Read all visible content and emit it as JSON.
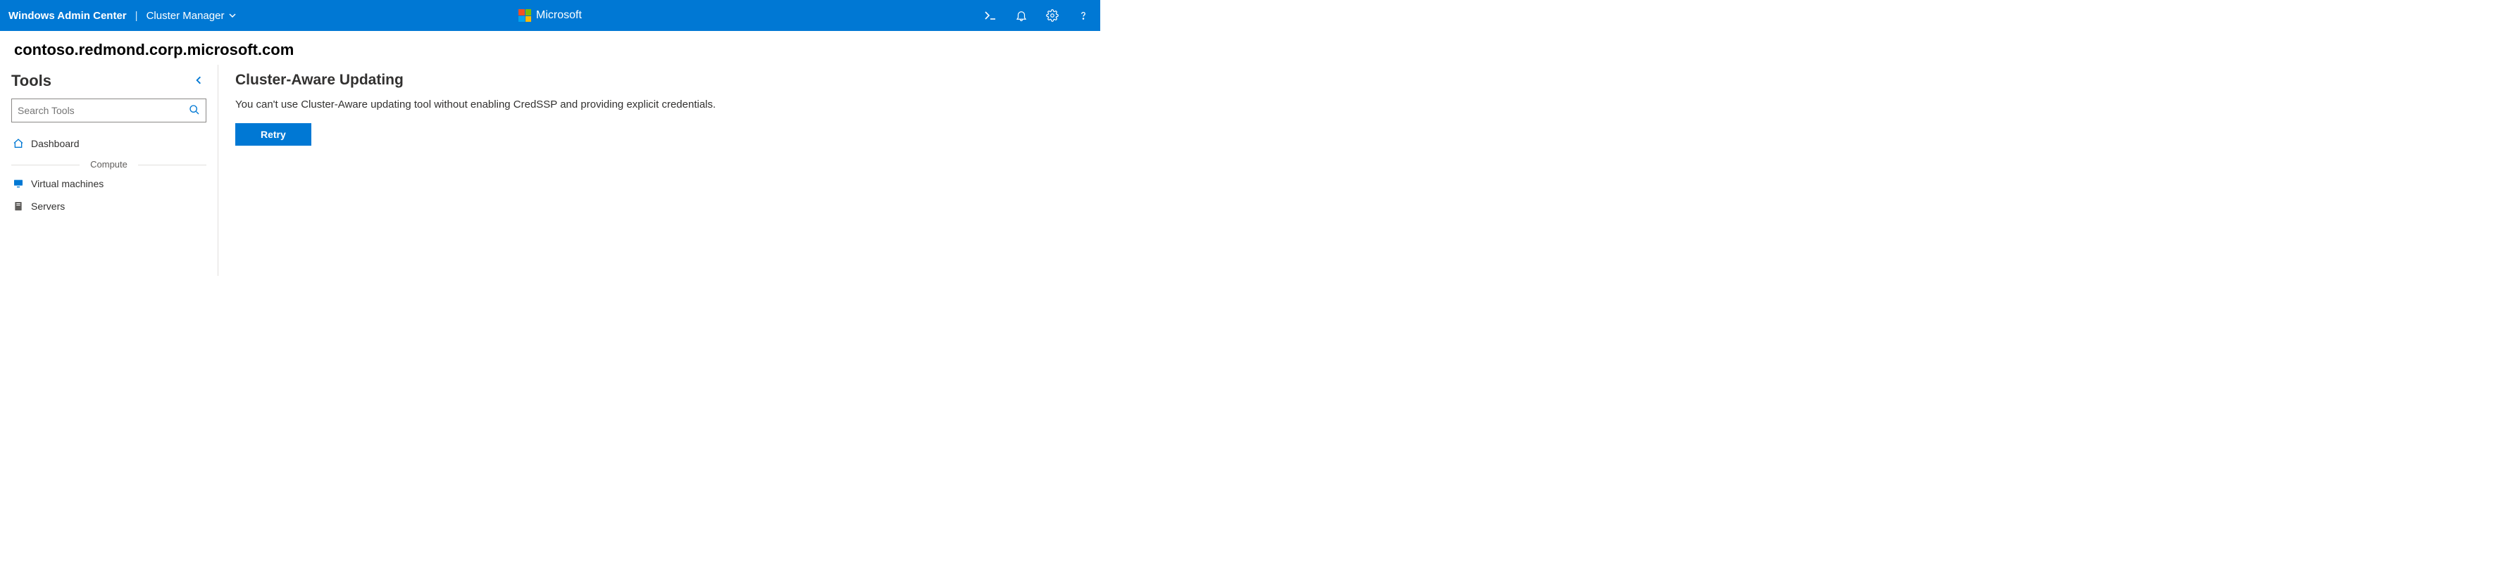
{
  "header": {
    "product": "Windows Admin Center",
    "scope_label": "Cluster Manager",
    "brand": "Microsoft"
  },
  "breadcrumb": {
    "host": "contoso.redmond.corp.microsoft.com"
  },
  "sidebar": {
    "title": "Tools",
    "search_placeholder": "Search Tools",
    "items": [
      {
        "label": "Dashboard"
      }
    ],
    "group_label": "Compute",
    "compute_items": [
      {
        "label": "Virtual machines"
      },
      {
        "label": "Servers"
      }
    ]
  },
  "main": {
    "title": "Cluster-Aware Updating",
    "message": "You can't use Cluster-Aware updating tool without enabling CredSSP and providing explicit credentials.",
    "retry_label": "Retry"
  }
}
